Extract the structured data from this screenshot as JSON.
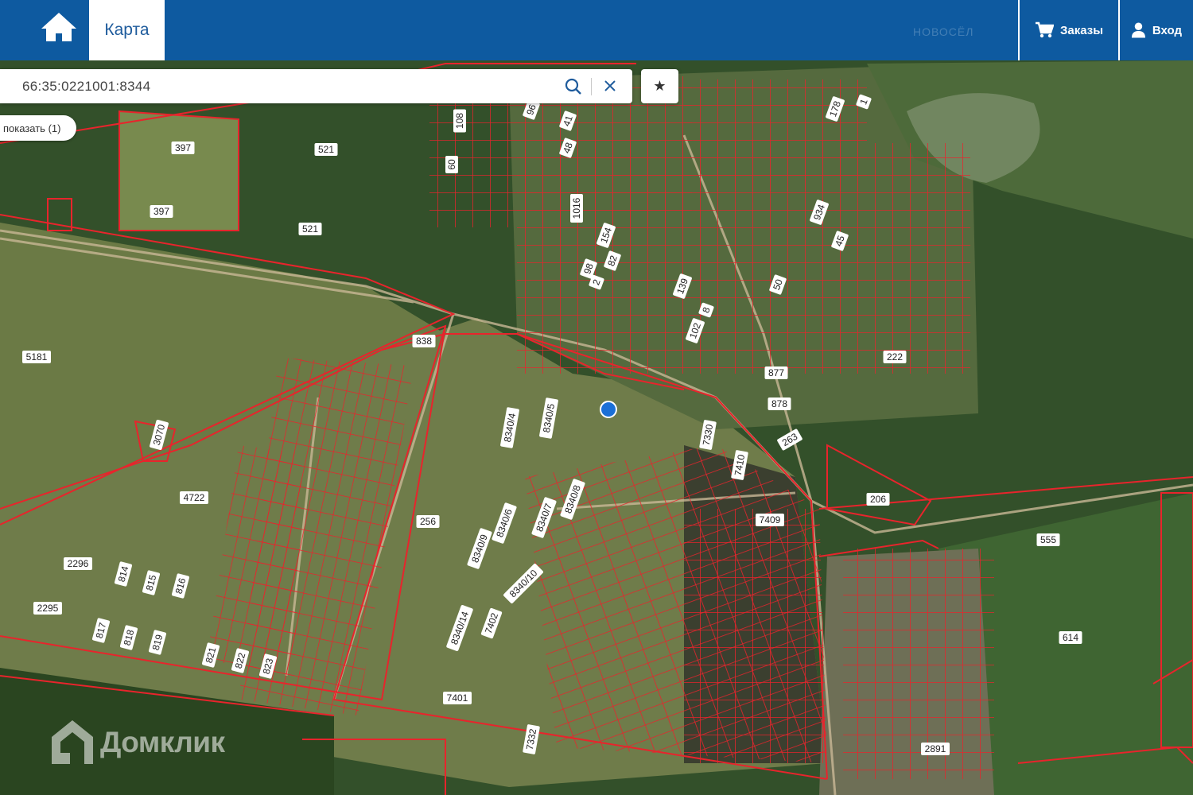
{
  "header": {
    "tab_map": "Карта",
    "orders_label": "Заказы",
    "login_label": "Вход",
    "brand_watermark": "НОВОСЁЛ"
  },
  "search": {
    "value": "66:35:0221001:8344"
  },
  "results_pill": "показать (1)",
  "watermark": {
    "text": "Домклик"
  },
  "colors": {
    "header_bg": "#0e5aa0",
    "parcel_border": "#e8242c",
    "marker": "#1a6fd6"
  },
  "icons": [
    "home-icon",
    "cart-icon",
    "user-icon",
    "search-icon",
    "close-icon",
    "star-icon",
    "domclick-logo-icon"
  ],
  "map": {
    "parcel_labels": [
      "397",
      "521",
      "397",
      "521",
      "108",
      "60",
      "96",
      "41",
      "48",
      "178",
      "1",
      "1016",
      "154",
      "98",
      "2",
      "82",
      "139",
      "8",
      "102",
      "50",
      "934",
      "45",
      "222",
      "877",
      "878",
      "263",
      "206",
      "555",
      "614",
      "2891",
      "838",
      "5181",
      "3070",
      "4722",
      "2296",
      "2295",
      "814",
      "815",
      "816",
      "817",
      "818",
      "819",
      "821",
      "822",
      "823",
      "256",
      "8340/4",
      "8340/5",
      "7330",
      "7410",
      "8340/8",
      "8340/7",
      "8340/6",
      "8340/9",
      "8340/10",
      "8340/14",
      "7402",
      "7409",
      "7401",
      "7332"
    ],
    "selected_marker": "selected-parcel-marker"
  }
}
